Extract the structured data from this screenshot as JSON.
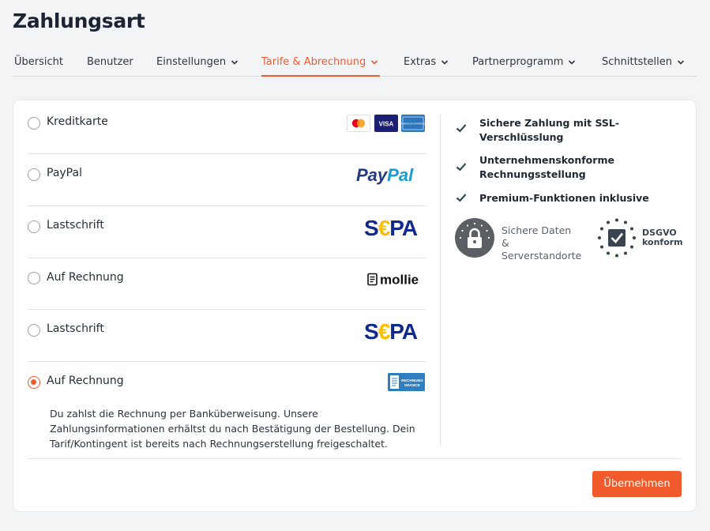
{
  "page": {
    "title": "Zahlungsart"
  },
  "tabs": [
    {
      "label": "Übersicht"
    },
    {
      "label": "Benutzer"
    },
    {
      "label": "Einstellungen"
    },
    {
      "label": "Tarife & Abrechnung"
    },
    {
      "label": "Extras"
    },
    {
      "label": "Partnerprogramm"
    },
    {
      "label": "Schnittstellen"
    }
  ],
  "methods": [
    {
      "label": "Kreditkarte",
      "selected": false,
      "logos": [
        "mastercard-logo",
        "visa-logo",
        "amex-logo"
      ],
      "logo_text": {
        "visa": "VISA",
        "amex": "AMERICAN EXPRESS"
      }
    },
    {
      "label": "PayPal",
      "selected": false,
      "logo": "paypal-logo",
      "logo_text": "PayPal"
    },
    {
      "label": "Lastschrift",
      "selected": false,
      "logo": "sepa-logo",
      "logo_text": "SEPA"
    },
    {
      "label": "Auf Rechnung",
      "selected": false,
      "logo": "mollie-logo",
      "logo_text": "mollie"
    },
    {
      "label": "Lastschrift",
      "selected": false,
      "logo": "sepa-logo",
      "logo_text": "SEPA"
    },
    {
      "label": "Auf Rechnung",
      "selected": true,
      "logo": "rechnung-invoice-logo",
      "logo_text": "RECHNUNG INVOICE",
      "description": "Du zahlst die Rechnung per Banküberweisung. Unsere Zahlungsinformationen erhältst du nach Bestätigung der Bestellung. Dein Tarif/Kontingent ist bereits nach Rechnungserstellung freigeschaltet."
    }
  ],
  "features": [
    {
      "text": "Sichere Zahlung mit SSL-Verschlüsslung"
    },
    {
      "text": "Unternehmenskonforme Rechnungsstellung"
    },
    {
      "text": "Premium-Funktionen inklusive"
    }
  ],
  "badges": {
    "secure": {
      "line1": "Sichere Daten &",
      "line2": "Serverstandorte"
    },
    "dsgvo": {
      "line1": "DSGVO",
      "line2": "konform"
    }
  },
  "actions": {
    "submit_label": "Übernehmen"
  },
  "colors": {
    "accent": "#ee5b30",
    "button": "#f15a2b",
    "check": "#2f4f4f",
    "sepa_blue": "#10298e",
    "sepa_yellow": "#ffbe00",
    "paypal_dark": "#253b80",
    "paypal_light": "#179bd7"
  }
}
